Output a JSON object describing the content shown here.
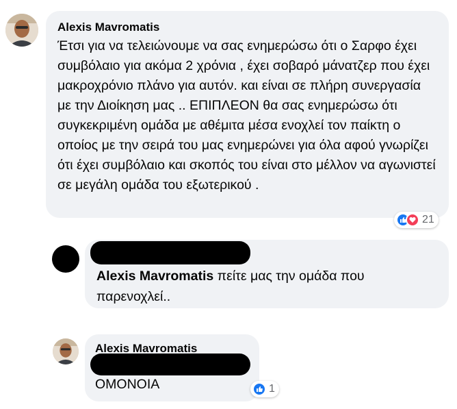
{
  "comments": [
    {
      "author": "Alexis Mavromatis",
      "text": "Έτσι για να τελειώνουμε να σας ενημερώσω ότι ο Σαρφο έχει συμβόλαιο για ακόμα 2 χρόνια , έχει σοβαρό μάνατζερ που έχει μακροχρόνιο πλάνο για αυτόν. και είναι σε πλήρη συνεργασία με την Διοίκηση μας .. ΕΠΙΠΛΕΟΝ θα σας ενημερώσω ότι συγκεκριμένη ομάδα με αθέμιτα μέσα ενοχλεί τον παίκτη ο οποίος με την σειρά του μας ενημερώνει για όλα αφού γνωρίζει ότι έχει συμβόλαιο και σκοπός του είναι στο μέλλον να αγωνιστεί σε μεγάλη ομάδα του εξωτερικού .",
      "reactions": {
        "icons": [
          "like-icon",
          "love-icon"
        ],
        "count": "21"
      }
    },
    {
      "author": "",
      "mention": "Alexis Mavromatis",
      "text": " πείτε μας την ομάδα που παρενοχλεί.."
    },
    {
      "author": "Alexis Mavromatis",
      "text": "ΟΜΟΝΟΙΑ",
      "reactions": {
        "icons": [
          "like-icon"
        ],
        "count": "1"
      }
    }
  ],
  "colors": {
    "bubble": "#f0f2f5",
    "like": "#1877f2",
    "love": "#f33e58",
    "muted": "#65676b"
  }
}
